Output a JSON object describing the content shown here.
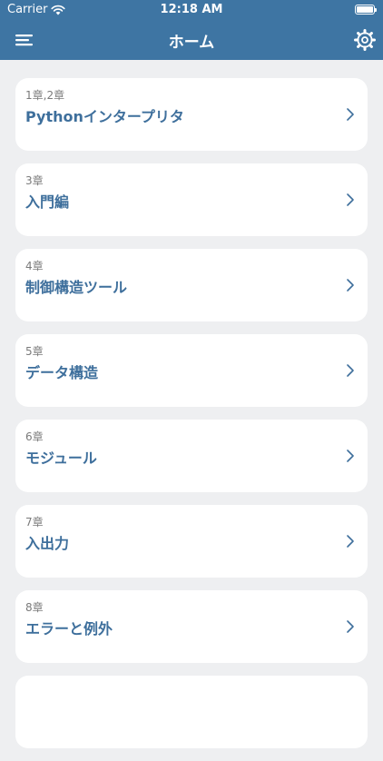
{
  "status_bar": {
    "carrier": "Carrier",
    "time": "12:18 AM"
  },
  "nav": {
    "title": "ホーム",
    "left_icon": "hamburger-menu-icon",
    "right_icon": "gear-icon"
  },
  "cards": [
    {
      "chapter": "1章,2章",
      "title": "Pythonインタープリタ"
    },
    {
      "chapter": "3章",
      "title": "入門編"
    },
    {
      "chapter": "4章",
      "title": "制御構造ツール"
    },
    {
      "chapter": "5章",
      "title": "データ構造"
    },
    {
      "chapter": "6章",
      "title": "モジュール"
    },
    {
      "chapter": "7章",
      "title": "入出力"
    },
    {
      "chapter": "8章",
      "title": "エラーと例外"
    },
    {
      "chapter": "",
      "title": ""
    }
  ],
  "colors": {
    "header": "#3e75a3",
    "background": "#eeeff1",
    "card": "#ffffff",
    "title_text": "#3e6f9c",
    "chapter_text": "#7a7a7a",
    "chevron": "#3e6f9c"
  }
}
